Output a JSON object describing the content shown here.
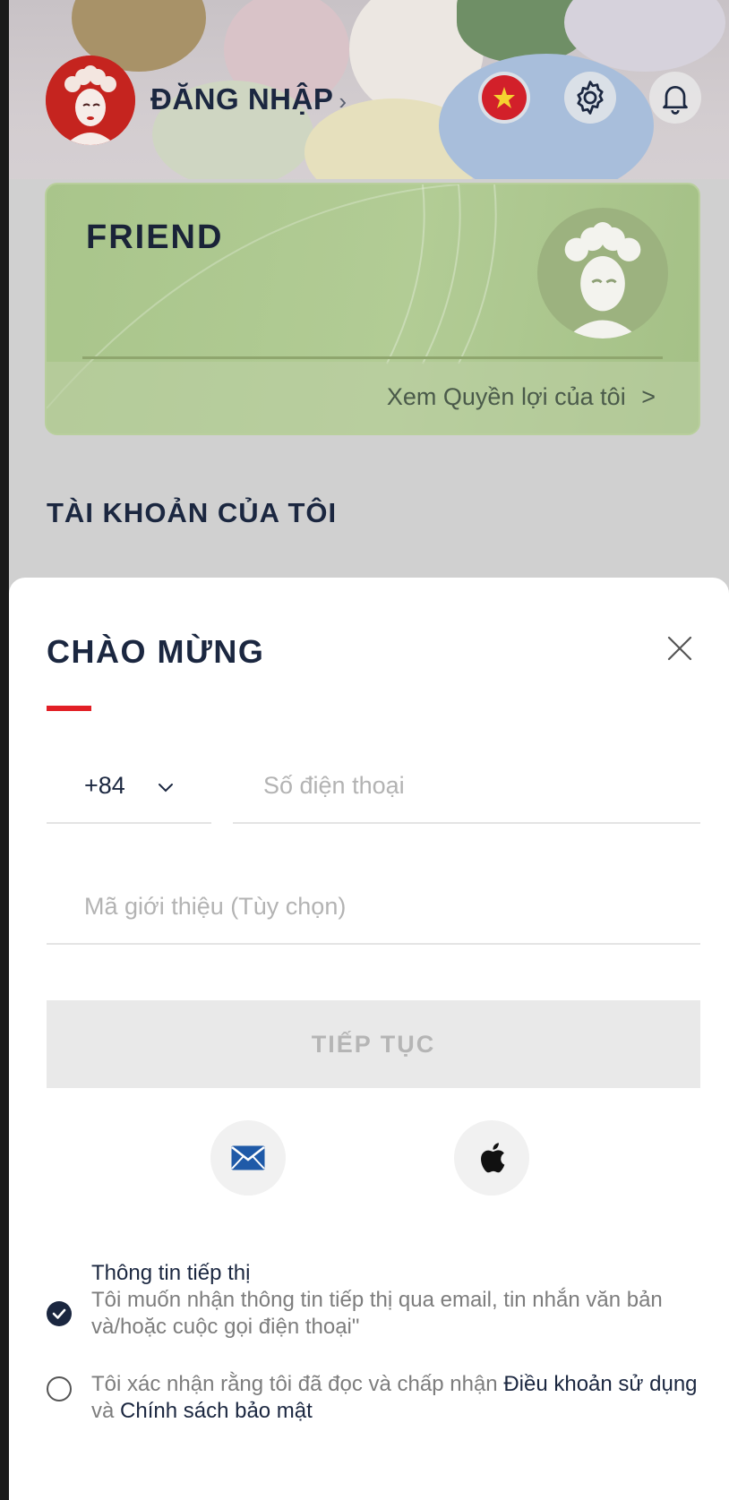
{
  "header": {
    "login_label": "ĐĂNG NHẬP",
    "login_chevron": "›"
  },
  "member_card": {
    "tier": "FRIEND",
    "benefits_link": "Xem Quyền lợi của tôi",
    "benefits_chevron": ">"
  },
  "section": {
    "title": "TÀI KHOẢN CỦA TÔI"
  },
  "sheet": {
    "title": "CHÀO MỪNG",
    "country_code": "+84",
    "phone_placeholder": "Số điện thoại",
    "referral_placeholder": "Mã giới thiệu (Tùy chọn)",
    "continue_label": "TIẾP TỤC",
    "marketing": {
      "title": "Thông tin tiếp thị",
      "body": "Tôi muốn nhận thông tin tiếp thị qua email, tin nhắn văn bản và/hoặc cuộc gọi điện thoại\"",
      "checked": true
    },
    "terms": {
      "prefix": "Tôi xác nhận rằng tôi đã đọc và chấp nhận ",
      "terms_link": "Điều khoản sử dụng",
      "middle": " và ",
      "privacy_link": "Chính sách bảo mật",
      "checked": false
    }
  },
  "colors": {
    "brand_navy": "#1b2740",
    "accent_red": "#e21f26",
    "card_green": "#a9c58b",
    "check_blue": "#1b2740"
  },
  "icons": {
    "flag": "vietnam-flag-icon",
    "settings": "gear-icon",
    "notifications": "bell-icon",
    "close": "close-icon",
    "dropdown": "chevron-down-icon",
    "email": "envelope-icon",
    "apple": "apple-icon"
  }
}
